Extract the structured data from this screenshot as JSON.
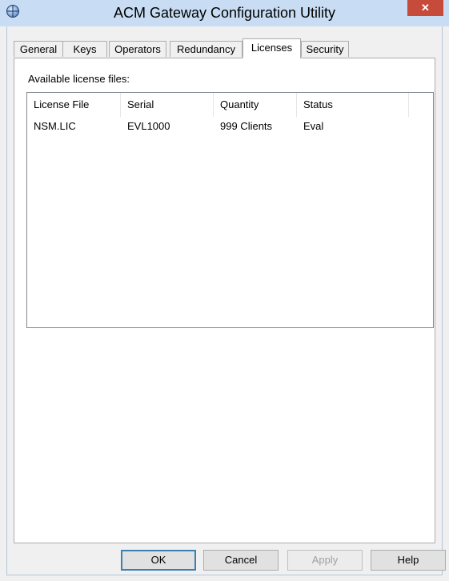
{
  "window": {
    "title": "ACM Gateway Configuration Utility",
    "close_glyph": "✕"
  },
  "tabs": [
    {
      "label": "General",
      "active": false
    },
    {
      "label": "Keys",
      "active": false
    },
    {
      "label": "Operators",
      "active": false
    },
    {
      "label": "Redundancy",
      "active": false
    },
    {
      "label": "Licenses",
      "active": true
    },
    {
      "label": "Security",
      "active": false
    }
  ],
  "licenses": {
    "section_label": "Available license files:",
    "columns": [
      "License File",
      "Serial",
      "Quantity",
      "Status"
    ],
    "rows": [
      [
        "NSM.LIC",
        "EVL1000",
        "999 Clients",
        "Eval"
      ]
    ]
  },
  "buttons": {
    "ok": "OK",
    "cancel": "Cancel",
    "apply": "Apply",
    "help": "Help"
  }
}
